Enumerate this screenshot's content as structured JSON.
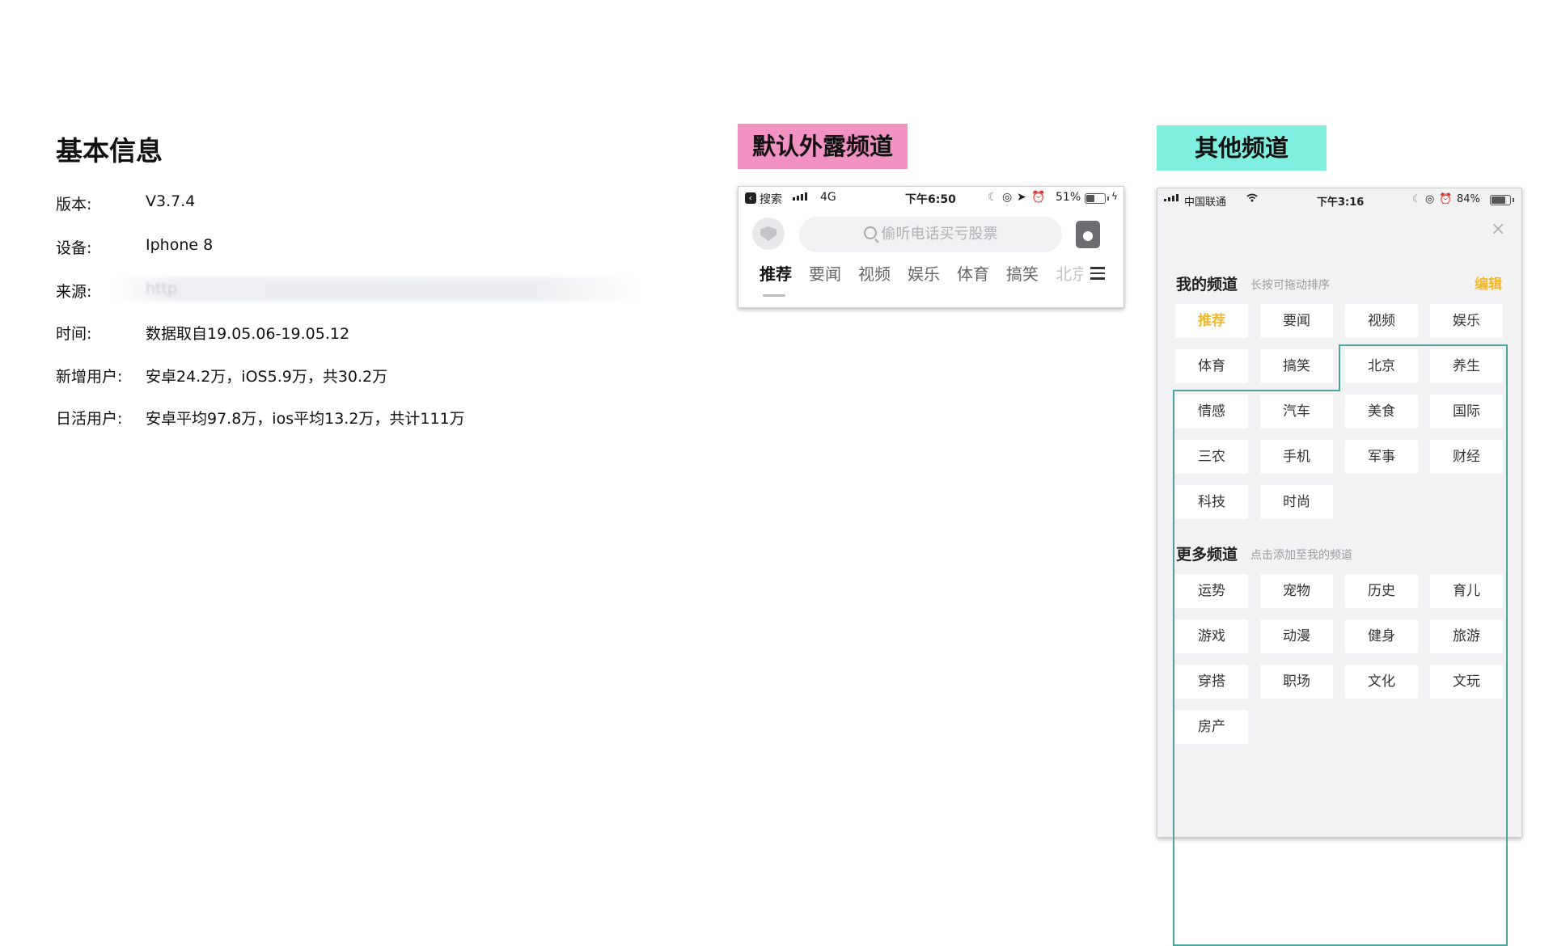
{
  "info": {
    "title": "基本信息",
    "rows": [
      {
        "label": "版本:",
        "value": "V3.7.4"
      },
      {
        "label": "设备:",
        "value": "Iphone 8"
      },
      {
        "label": "来源:",
        "value": "http"
      },
      {
        "label": "时间:",
        "value": "数据取自19.05.06-19.05.12"
      },
      {
        "label": "新增用户:",
        "value": "安卓24.2万，iOS5.9万，共30.2万"
      },
      {
        "label": "日活用户:",
        "value": "安卓平均97.8万，ios平均13.2万，共计111万"
      }
    ]
  },
  "labels": {
    "default_channels": "默认外露频道",
    "other_channels": "其他频道",
    "default_color": "#f192c3",
    "other_color": "#7fefe0"
  },
  "phone1": {
    "status": {
      "back": "搜索",
      "network": "4G",
      "time": "下午6:50",
      "battery": "51%",
      "battery_level": 0.51
    },
    "search_placeholder": "偷听电话买亏股票",
    "tabs": [
      "推荐",
      "要闻",
      "视频",
      "娱乐",
      "体育",
      "搞笑",
      "北京"
    ],
    "active_tab": "推荐",
    "icons": [
      "back-icon",
      "signal-icon",
      "moon-icon",
      "lock-rotation-icon",
      "location-icon",
      "alarm-icon",
      "battery-icon",
      "charging-icon",
      "avatar-icon",
      "search-icon",
      "gift-icon",
      "menu-icon"
    ]
  },
  "phone2": {
    "status": {
      "carrier": "中国联通",
      "time": "下午3:16",
      "battery": "84%",
      "battery_level": 0.84
    },
    "my_channels": {
      "title": "我的频道",
      "hint": "长按可拖动排序",
      "edit": "编辑",
      "items": [
        "推荐",
        "要闻",
        "视频",
        "娱乐",
        "体育",
        "搞笑",
        "北京",
        "养生",
        "情感",
        "汽车",
        "美食",
        "国际",
        "三农",
        "手机",
        "军事",
        "财经",
        "科技",
        "时尚"
      ],
      "active": "推荐"
    },
    "more_channels": {
      "title": "更多频道",
      "hint": "点击添加至我的频道",
      "items": [
        "运势",
        "宠物",
        "历史",
        "育儿",
        "游戏",
        "动漫",
        "健身",
        "旅游",
        "穿搭",
        "职场",
        "文化",
        "文玩",
        "房产"
      ]
    },
    "close": "×",
    "accent_color": "#f0b82e",
    "outline_color": "#4aa59c"
  }
}
